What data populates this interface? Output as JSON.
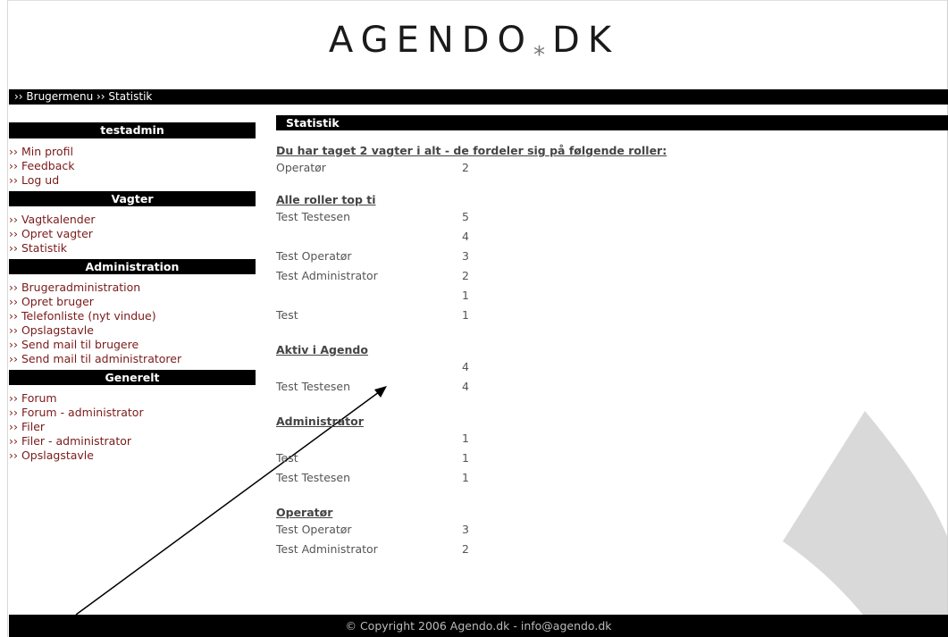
{
  "logo": {
    "part1": "AGENDO",
    "star": "*",
    "part2": "DK"
  },
  "breadcrumb": {
    "text": "›› Brugermenu ›› Statistik"
  },
  "sidebar": {
    "user": {
      "title": "testadmin",
      "items": [
        "›› Min profil",
        "›› Feedback",
        "›› Log ud"
      ]
    },
    "vagter": {
      "title": "Vagter",
      "items": [
        "›› Vagtkalender",
        "›› Opret vagter",
        "›› Statistik"
      ]
    },
    "administration": {
      "title": "Administration",
      "items": [
        "›› Brugeradministration",
        "›› Opret bruger",
        "›› Telefonliste (nyt vindue)",
        "›› Opslagstavle",
        "›› Send mail til brugere",
        "›› Send mail til administratorer"
      ]
    },
    "generelt": {
      "title": "Generelt",
      "items": [
        "›› Forum",
        "›› Forum - administrator",
        "›› Filer",
        "›› Filer - administrator",
        "›› Opslagstavle"
      ]
    }
  },
  "main": {
    "heading": "Statistik",
    "summary": {
      "title": "Du har taget 2 vagter i alt - de fordeler sig på følgende roller:",
      "rows": [
        {
          "name": "Operatør",
          "value": "2"
        }
      ]
    },
    "top_ti": {
      "title": "Alle roller top ti",
      "rows": [
        {
          "name": "Test Testesen",
          "value": "5"
        },
        {
          "name": "",
          "value": "4"
        },
        {
          "name": "Test Operatør",
          "value": "3"
        },
        {
          "name": "Test Administrator",
          "value": "2"
        },
        {
          "name": "",
          "value": "1"
        },
        {
          "name": "Test",
          "value": "1"
        }
      ]
    },
    "aktiv": {
      "title": "Aktiv i Agendo",
      "rows": [
        {
          "name": "",
          "value": "4"
        },
        {
          "name": "Test Testesen",
          "value": "4"
        }
      ]
    },
    "administrator": {
      "title": "Administrator",
      "rows": [
        {
          "name": "",
          "value": "1"
        },
        {
          "name": "Test",
          "value": "1"
        },
        {
          "name": "Test Testesen",
          "value": "1"
        }
      ]
    },
    "operator": {
      "title": "Operatør",
      "rows": [
        {
          "name": "Test Operatør",
          "value": "3"
        },
        {
          "name": "Test Administrator",
          "value": "2"
        }
      ]
    }
  },
  "footer": {
    "text": "© Copyright 2006 Agendo.dk - info@agendo.dk"
  },
  "colors": {
    "link": "#7a1a1a",
    "bar": "#000000",
    "text": "#555555",
    "deco": "#d9d9d9"
  }
}
